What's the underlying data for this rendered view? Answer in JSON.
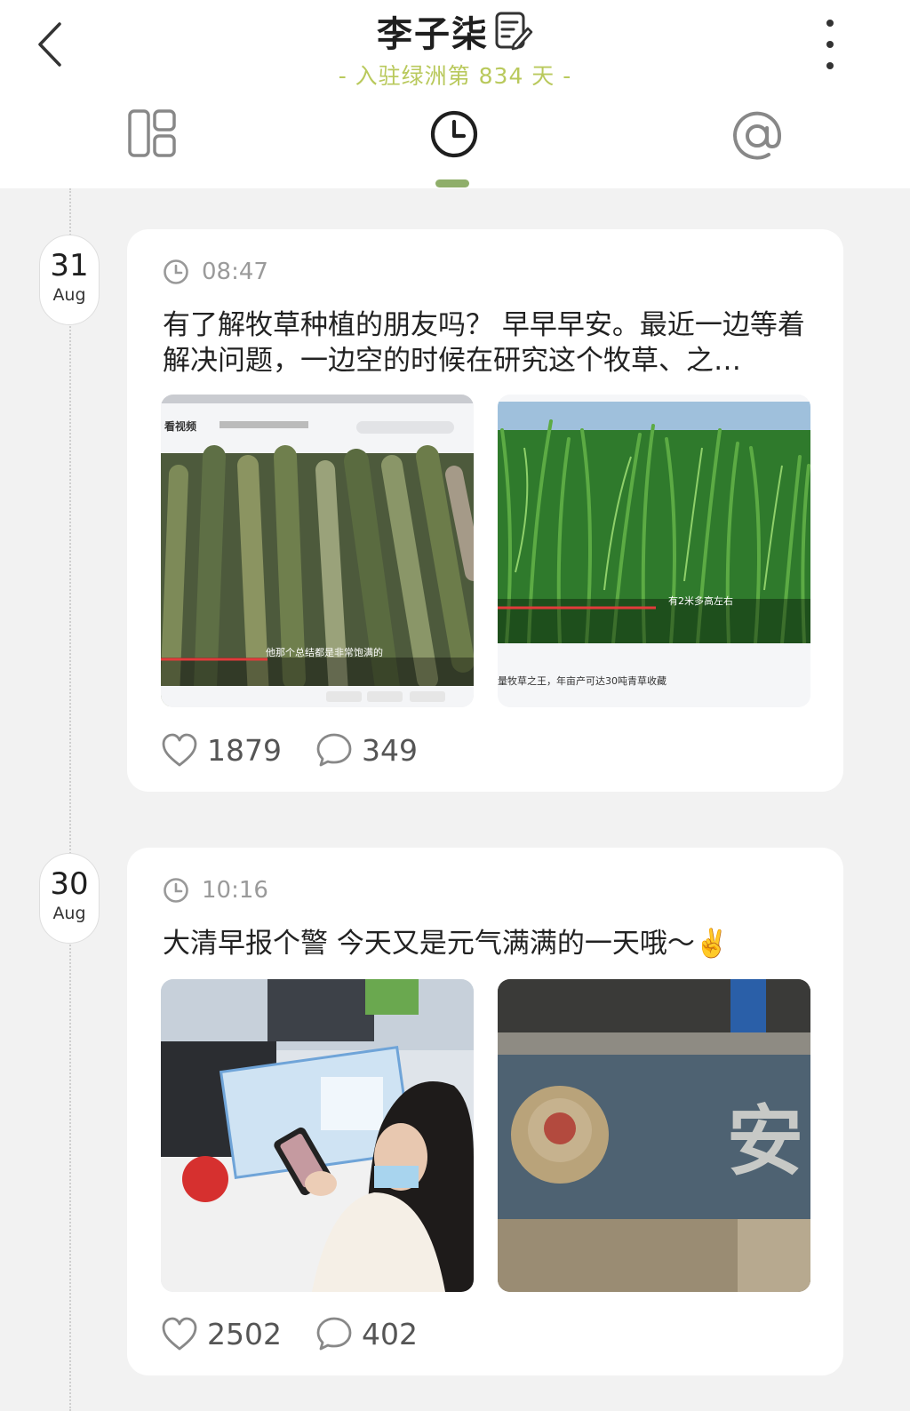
{
  "header": {
    "title": "李子柒",
    "subtitle": "- 入驻绿洲第 834 天 -"
  },
  "tabs": [
    {
      "name": "grid",
      "icon": "grid-layout-icon"
    },
    {
      "name": "timeline",
      "icon": "clock-icon",
      "active": true
    },
    {
      "name": "mentions",
      "icon": "at-icon"
    }
  ],
  "colors": {
    "accent": "#8fae6a",
    "subtitle": "#b9c95c",
    "background": "#f2f2f2",
    "card": "#ffffff"
  },
  "posts": [
    {
      "date": {
        "day": "31",
        "month": "Aug"
      },
      "time": "08:47",
      "text": "有了解牧草种植的朋友吗？ 早早早安。最近一边等着解决问题，一边空的时候在研究这个牧草、之…",
      "photos": [
        {
          "desc": "cut-grass-stalks-video-screenshot",
          "overlay": "他那个总结都是非常饱满的"
        },
        {
          "desc": "tall-green-grass-video-screenshot",
          "overlay": "有2米多高左右",
          "caption": "量牧草之王，年亩产可达30吨青草收藏"
        }
      ],
      "likes": "1879",
      "comments": "349"
    },
    {
      "date": {
        "day": "30",
        "month": "Aug"
      },
      "time": "10:16",
      "text": "大清早报个警 今天又是元气满满的一天哦～✌️",
      "photos": [
        {
          "desc": "woman-at-service-counter-photo"
        },
        {
          "desc": "police-badge-wall-photo",
          "overlay": "安"
        }
      ],
      "likes": "2502",
      "comments": "402"
    }
  ]
}
